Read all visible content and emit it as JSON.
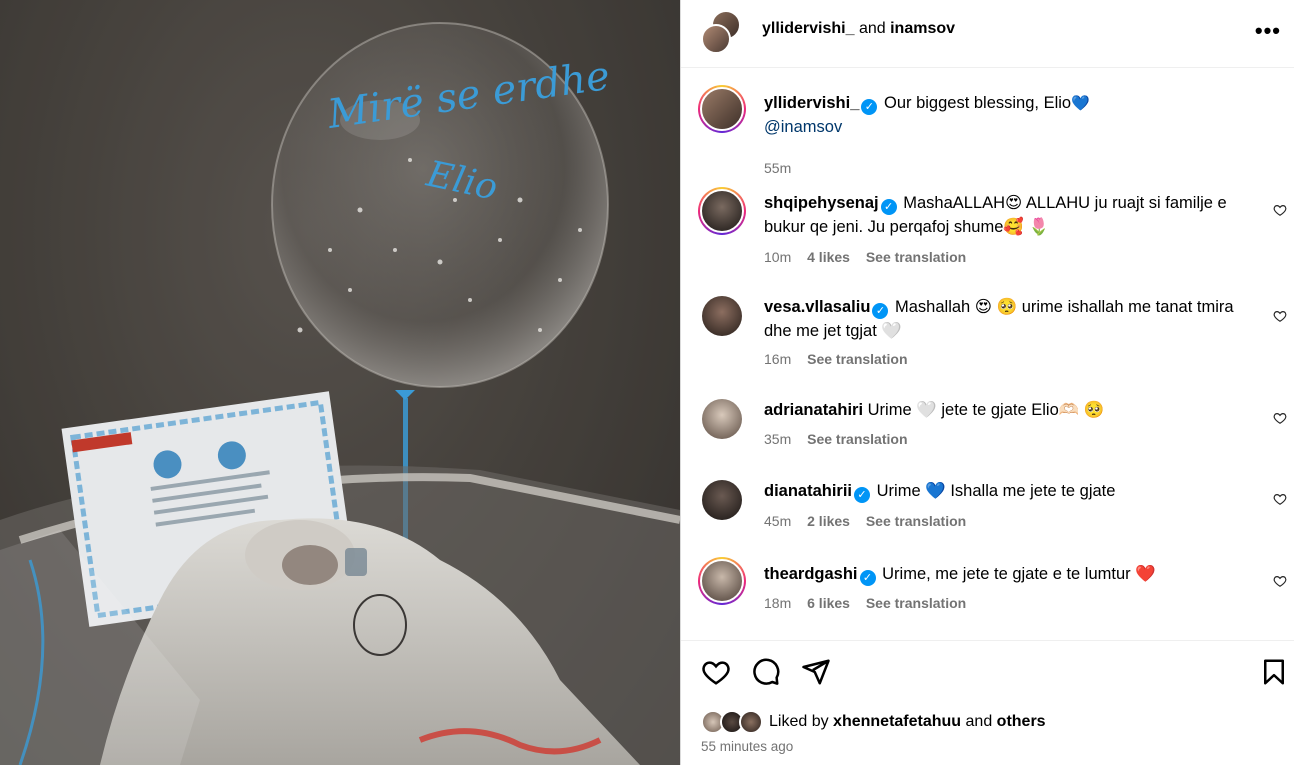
{
  "header": {
    "user1": "yllidervishi_",
    "and": "and",
    "user2": "inamsov",
    "more_icon": "•••"
  },
  "photo": {
    "balloon_text1": "Mirë se erdhe",
    "balloon_text2": "Elio"
  },
  "caption": {
    "username": "yllidervishi_",
    "text": "Our biggest blessing, Elio",
    "emoji": "💙",
    "mention": "@inamsov",
    "time": "55m"
  },
  "comments": [
    {
      "username": "shqipehysenaj",
      "verified": true,
      "line1": "MashaALLAH😍  ALLAHU ju ruajt si familje e",
      "line2": "bukur qe jeni. Ju perqafoj shume🥰 🌷",
      "time": "10m",
      "likes": "4 likes",
      "translation": "See translation"
    },
    {
      "username": "vesa.vllasaliu",
      "verified": true,
      "line1": "Mashallah 😍 🥺  urime ishallah me tanat tmira",
      "line2": "dhe me jet tgjat 🤍",
      "time": "16m",
      "likes": "",
      "translation": "See translation"
    },
    {
      "username": "adrianatahiri",
      "verified": false,
      "line1": "Urime 🤍  jete te gjate Elio🫶🏻 🥺",
      "line2": "",
      "time": "35m",
      "likes": "",
      "translation": "See translation"
    },
    {
      "username": "dianatahirii",
      "verified": true,
      "line1": "Urime  💙  Ishalla me jete te gjate",
      "line2": "",
      "time": "45m",
      "likes": "2 likes",
      "translation": "See translation"
    },
    {
      "username": "theardgashi",
      "verified": true,
      "line1": "Urime, me jete te gjate e te lumtur  ❤️",
      "line2": "",
      "time": "18m",
      "likes": "6 likes",
      "translation": "See translation"
    }
  ],
  "footer": {
    "liked_by": "Liked by",
    "liked_user": "xhennetafetahuu",
    "and": "and",
    "others": "others",
    "time_ago": "55 minutes ago"
  },
  "colors": {
    "verified": "#0095f6",
    "secondary_text": "#737373",
    "mention": "#00376b",
    "balloon_text": "#3b9bd6"
  }
}
